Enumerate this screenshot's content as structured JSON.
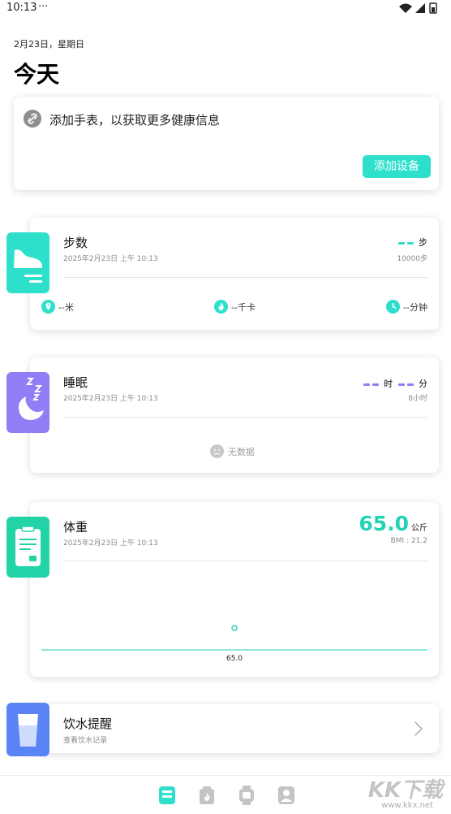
{
  "status_bar": {
    "time": "10:13",
    "dots": "···"
  },
  "header": {
    "date": "2月23日，星期日",
    "title": "今天"
  },
  "watch_card": {
    "text": "添加手表，以获取更多健康信息",
    "button_label": "添加设备",
    "icon": "link-icon"
  },
  "steps": {
    "title": "步数",
    "time": "2025年2月23日 上午 10:13",
    "unit": "步",
    "goal": "10000步",
    "distance": "--米",
    "calories": "--千卡",
    "duration": "--分钟",
    "icon": "shoe-icon"
  },
  "sleep": {
    "title": "睡眠",
    "time": "2025年2月23日 上午 10:13",
    "hour_unit": "时",
    "minute_unit": "分",
    "goal": "8小时",
    "empty_text": "无数据",
    "icon": "moon-icon"
  },
  "weight": {
    "title": "体重",
    "time": "2025年2月23日 上午 10:13",
    "value": "65.0",
    "unit": "公斤",
    "bmi": "BMI : 21.2",
    "icon": "scale-icon",
    "chart_point_label": "65.0"
  },
  "water": {
    "title": "饮水提醒",
    "subtitle": "查看饮水记录",
    "icon": "cup-icon"
  },
  "bottom_nav": {
    "items": [
      {
        "name": "today",
        "icon": "today-icon",
        "active": true
      },
      {
        "name": "fitness",
        "icon": "fitness-icon",
        "active": false
      },
      {
        "name": "device",
        "icon": "watch-icon",
        "active": false
      },
      {
        "name": "profile",
        "icon": "profile-icon",
        "active": false
      }
    ]
  },
  "watermark": {
    "text": "KK下载",
    "url": "www.kkx.net"
  },
  "colors": {
    "accent": "#2ee0cc",
    "weight": "#22d3b5",
    "sleep": "#8f7ef5",
    "water": "#5a83f5"
  }
}
